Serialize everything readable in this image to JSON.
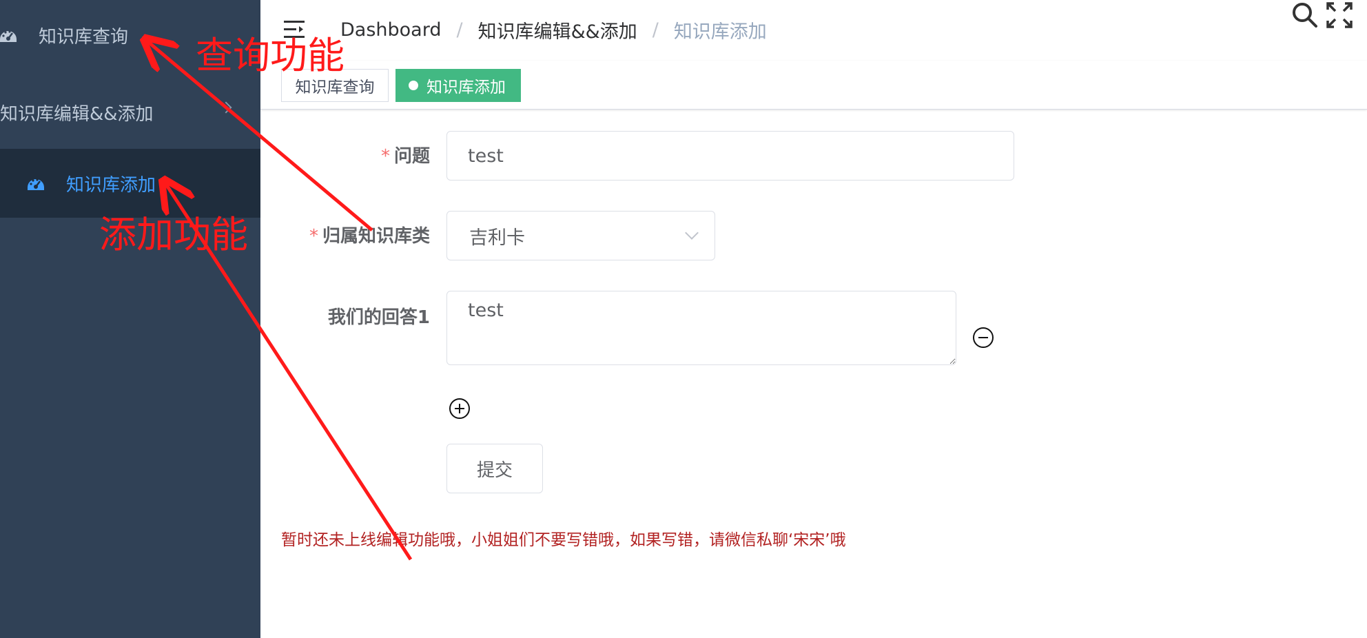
{
  "sidebar": {
    "items": [
      {
        "label": "知识库查询",
        "icon": "dashboard-icon"
      },
      {
        "label": "知识库编辑&&添加",
        "icon": "chevron-right-icon"
      },
      {
        "label": "知识库添加",
        "icon": "dashboard-icon"
      }
    ],
    "colors": {
      "bg": "#304156",
      "active_bg": "#1f2d3d",
      "active_text": "#409eff",
      "text": "#bfcbd9"
    }
  },
  "navbar": {
    "breadcrumb": [
      "Dashboard",
      "知识库编辑&&添加",
      "知识库添加"
    ],
    "separator": "/",
    "icons": [
      "hamburger-icon",
      "search-icon",
      "fullscreen-icon"
    ]
  },
  "tags": [
    {
      "label": "知识库查询",
      "active": false
    },
    {
      "label": "知识库添加",
      "active": true,
      "color": "#42b983"
    }
  ],
  "form": {
    "question": {
      "label": "问题",
      "required": "*",
      "value": "test"
    },
    "category": {
      "label": "归属知识库类",
      "required": "*",
      "value": "吉利卡"
    },
    "answer": {
      "label": "我们的回答1",
      "value": "test"
    },
    "submit_label": "提交",
    "notice": "暂时还未上线编辑功能哦，小姐姐们不要写错哦，如果写错，请微信私聊‘宋宋’哦"
  },
  "annotations": {
    "query_feature": "查询功能",
    "add_feature": "添加功能",
    "color": "#ff1a1a"
  }
}
